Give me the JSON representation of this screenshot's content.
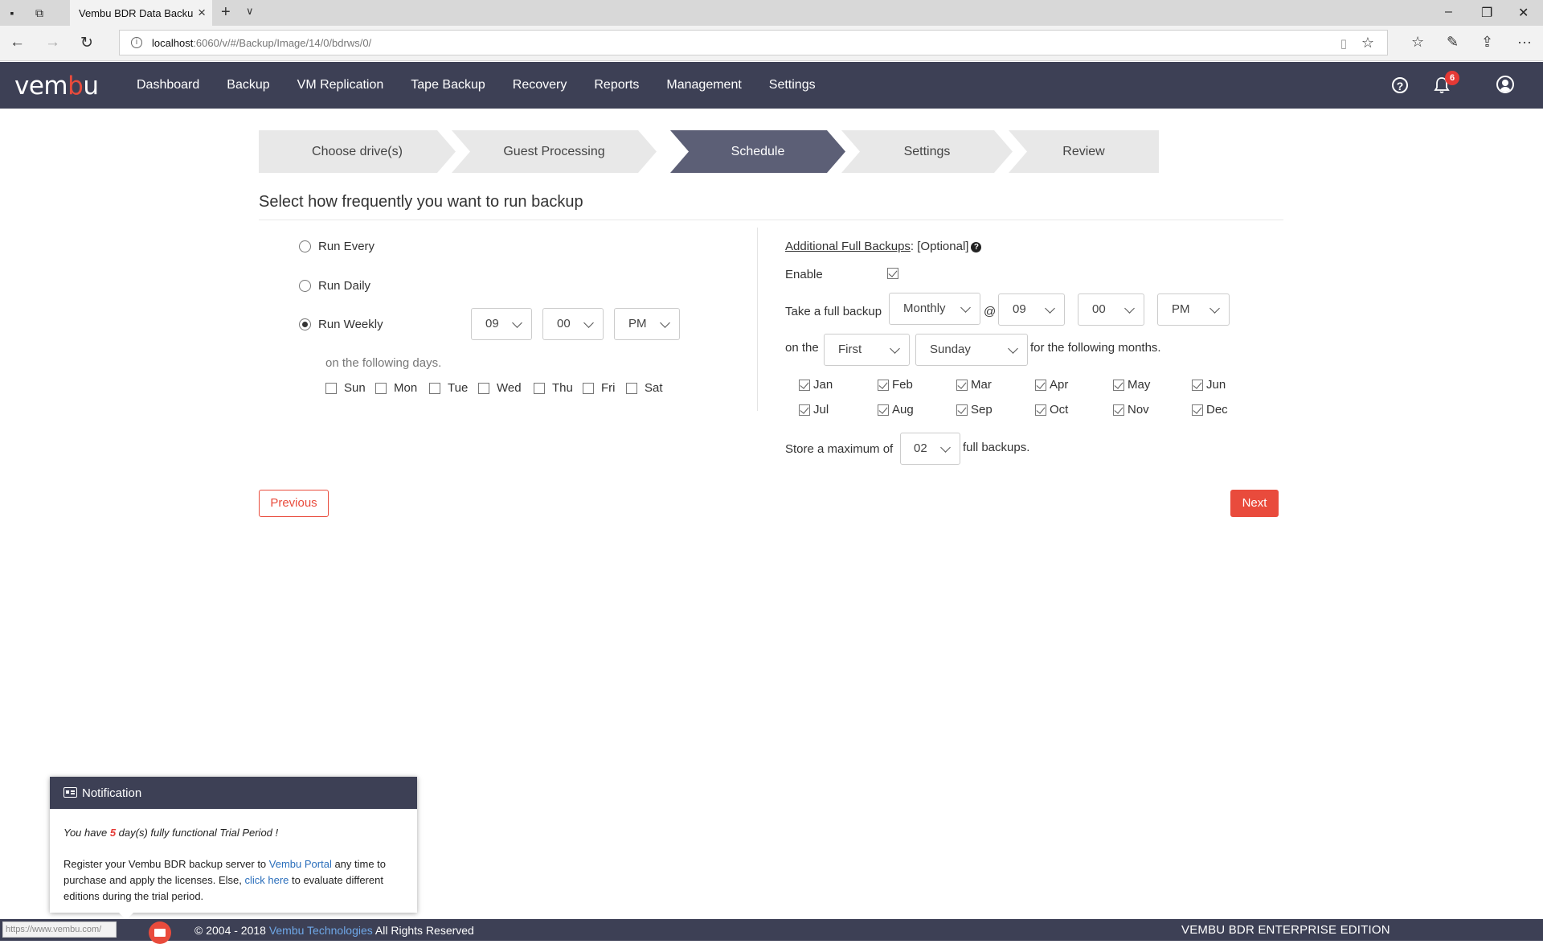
{
  "browser": {
    "tab_title": "Vembu BDR Data Backu",
    "url_host": "localhost",
    "url_rest": ":6060/v/#/Backup/Image/14/0/bdrws/0/",
    "status_url": "https://www.vembu.com/"
  },
  "header": {
    "logo_pre": "vem",
    "logo_b": "b",
    "logo_post": "u",
    "nav": [
      "Dashboard",
      "Backup",
      "VM Replication",
      "Tape Backup",
      "Recovery",
      "Reports",
      "Management",
      "Settings"
    ],
    "notification_count": "6",
    "help_glyph": "?"
  },
  "wizard": {
    "steps": [
      "Choose drive(s)",
      "Guest Processing",
      "Schedule",
      "Settings",
      "Review"
    ],
    "active_index": 2,
    "colors": {
      "inactive": "#e8e8e8",
      "active": "#5c5f76"
    }
  },
  "schedule": {
    "title": "Select how frequently you want to run backup",
    "options": [
      "Run Every",
      "Run Daily",
      "Run Weekly"
    ],
    "selected_option": "Run Weekly",
    "weekly_hour": "09",
    "weekly_minute": "00",
    "weekly_ampm": "PM",
    "days_hint": "on the following days.",
    "days": [
      {
        "label": "Sun",
        "checked": false
      },
      {
        "label": "Mon",
        "checked": false
      },
      {
        "label": "Tue",
        "checked": false
      },
      {
        "label": "Wed",
        "checked": false
      },
      {
        "label": "Thu",
        "checked": false
      },
      {
        "label": "Fri",
        "checked": false
      },
      {
        "label": "Sat",
        "checked": false
      }
    ]
  },
  "additional": {
    "heading": "Additional Full Backups",
    "optional": ": [Optional]",
    "enable_label": "Enable",
    "enable_checked": true,
    "take_label": "Take a full backup",
    "frequency": "Monthly",
    "at": "@",
    "hour": "09",
    "minute": "00",
    "ampm": "PM",
    "on_the": "on the",
    "week": "First",
    "weekday": "Sunday",
    "months_suffix": "for the following months.",
    "months": [
      {
        "label": "Jan",
        "checked": true
      },
      {
        "label": "Feb",
        "checked": true
      },
      {
        "label": "Mar",
        "checked": true
      },
      {
        "label": "Apr",
        "checked": true
      },
      {
        "label": "May",
        "checked": true
      },
      {
        "label": "Jun",
        "checked": true
      },
      {
        "label": "Jul",
        "checked": true
      },
      {
        "label": "Aug",
        "checked": true
      },
      {
        "label": "Sep",
        "checked": true
      },
      {
        "label": "Oct",
        "checked": true
      },
      {
        "label": "Nov",
        "checked": true
      },
      {
        "label": "Dec",
        "checked": true
      }
    ],
    "store_prefix": "Store a maximum of",
    "store_value": "02",
    "store_suffix": "full backups."
  },
  "buttons": {
    "previous": "Previous",
    "next": "Next"
  },
  "notification": {
    "title": "Notification",
    "trial_pre": "You have ",
    "trial_days": "5",
    "trial_post": " day(s) fully functional Trial Period !",
    "line1_pre": "Register your Vembu BDR backup server to ",
    "portal_link": "Vembu Portal",
    "line1_post": " any time to purchase and apply the licenses. Else, ",
    "click_link": "click here",
    "line2_post": " to evaluate different editions during the trial period."
  },
  "footer": {
    "copy_pre": "© 2004 - 2018 ",
    "company": "Vembu Technologies",
    "copy_post": " All Rights Reserved",
    "edition": "VEMBU BDR ENTERPRISE EDITION"
  },
  "colors": {
    "accent": "#e94b3c",
    "header_bg": "#3d4055",
    "link": "#2a6ebb"
  }
}
